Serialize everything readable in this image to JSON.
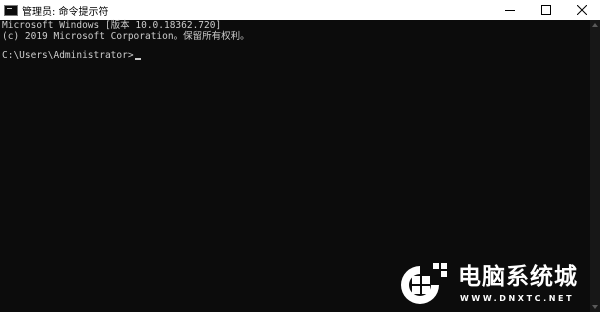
{
  "window": {
    "title": "管理员: 命令提示符",
    "icon": "cmd-icon"
  },
  "controls": {
    "minimize_icon": "minimize-icon",
    "maximize_icon": "maximize-icon",
    "close_icon": "close-icon"
  },
  "console": {
    "line1": "Microsoft Windows [版本 10.0.18362.720]",
    "line2": "(c) 2019 Microsoft Corporation。保留所有权利。",
    "prompt": "C:\\Users\\Administrator>",
    "text_color": "#cccccc",
    "background": "#0c0c0c"
  },
  "watermark": {
    "title": "电脑系统城",
    "url": "WWW.DNXTC.NET"
  }
}
